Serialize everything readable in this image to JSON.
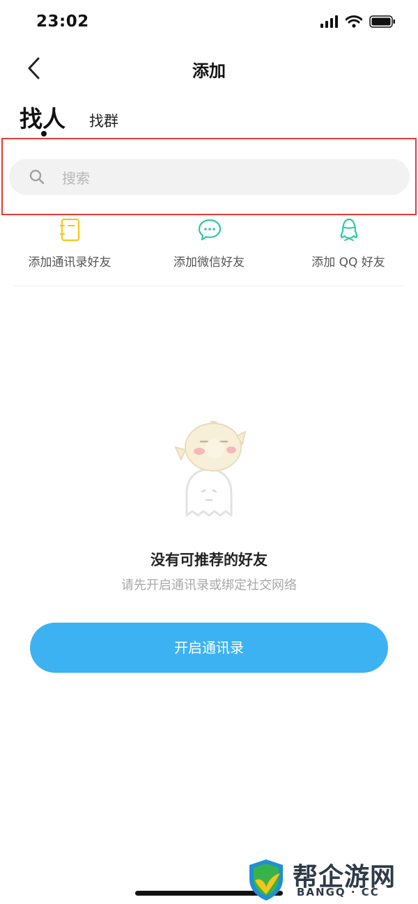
{
  "status_bar": {
    "time": "23:02"
  },
  "nav": {
    "title": "添加"
  },
  "tabs": [
    {
      "label": "找人",
      "active": true
    },
    {
      "label": "找群",
      "active": false
    }
  ],
  "search": {
    "placeholder": "搜索"
  },
  "quick_actions": [
    {
      "label": "添加通讯录好友",
      "icon": "contacts-book-icon",
      "color": "#f5c518"
    },
    {
      "label": "添加微信好友",
      "icon": "wechat-icon",
      "color": "#2dc9a0"
    },
    {
      "label": "添加 QQ 好友",
      "icon": "qq-icon",
      "color": "#2dc9a0"
    }
  ],
  "empty_state": {
    "title": "没有可推荐的好友",
    "subtitle": "请先开启通讯录或绑定社交网络",
    "illustration": "ghost-with-bird-illustration"
  },
  "primary_button": {
    "label": "开启通讯录"
  },
  "watermark": {
    "brand": "帮企游网",
    "domain": "BANGQ · CC"
  },
  "colors": {
    "accent": "#3db2f2",
    "highlight": "#e53935",
    "icon_yellow": "#f5c518",
    "icon_teal": "#2dc9a0"
  }
}
